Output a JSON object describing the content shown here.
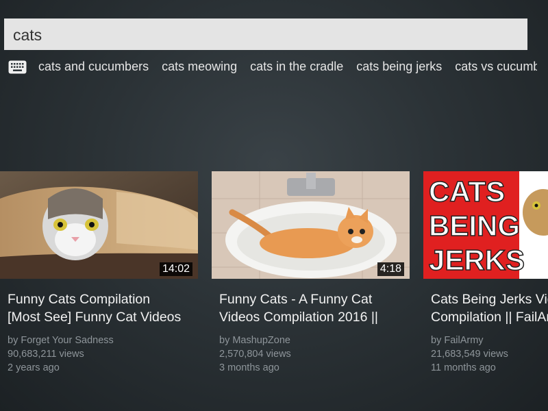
{
  "search": {
    "query": "cats"
  },
  "suggestions": [
    "cats and cucumbers",
    "cats meowing",
    "cats in the cradle",
    "cats being jerks",
    "cats vs cucumbers"
  ],
  "videos": [
    {
      "duration": "14:02",
      "title": "Funny Cats Compilation\n[Most See] Funny Cat Videos",
      "channel": "by Forget Your Sadness",
      "views": "90,683,211 views",
      "age": "2 years ago"
    },
    {
      "duration": "4:18",
      "title": "Funny Cats - A Funny Cat\nVideos Compilation 2016 ||",
      "channel": "by MashupZone",
      "views": "2,570,804 views",
      "age": "3 months ago"
    },
    {
      "thumb_text": [
        "CATS",
        "BEING",
        "JERKS"
      ],
      "title": "Cats Being Jerks Video\nCompilation || FailArmy",
      "channel": "by FailArmy",
      "views": "21,683,549 views",
      "age": "11 months ago"
    }
  ],
  "colors": {
    "accent_red": "#e02020"
  }
}
